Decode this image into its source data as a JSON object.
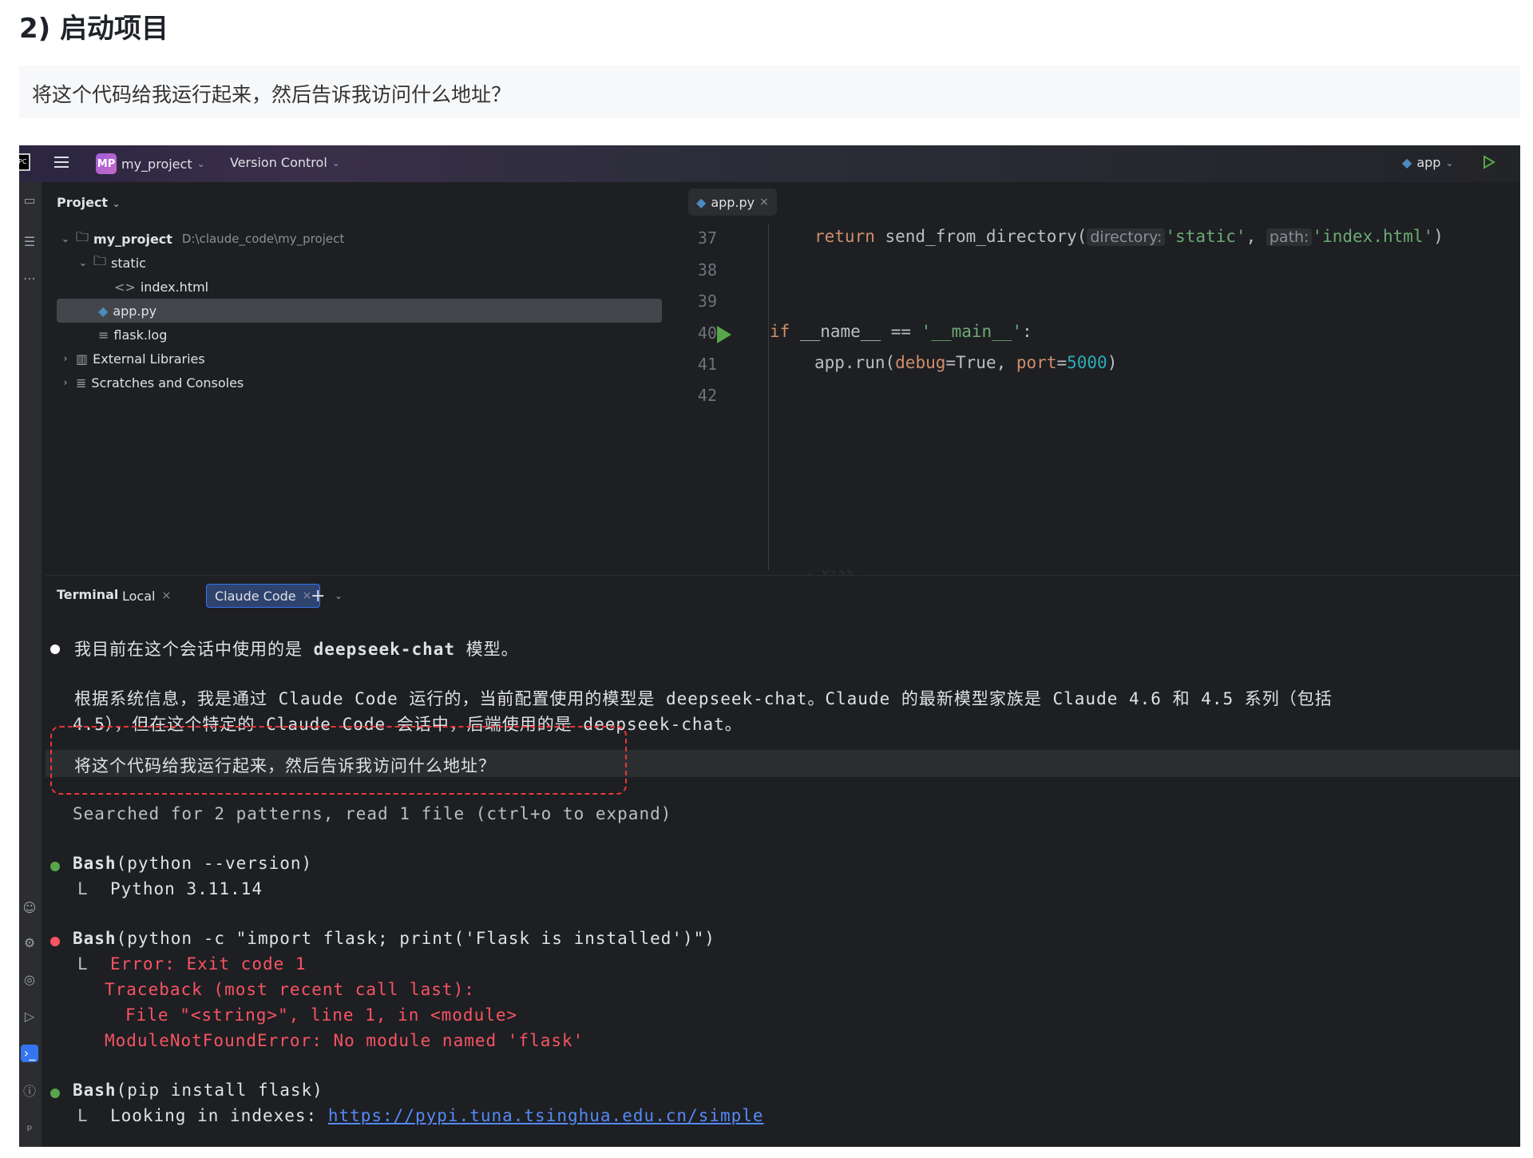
{
  "article": {
    "heading": "2) 启动项目",
    "quote": "将这个代码给我运行起来，然后告诉我访问什么地址？"
  },
  "titlebar": {
    "app_badge": "MP",
    "project_name": "my_project",
    "version_control": "Version Control",
    "run_config": "app"
  },
  "project_panel": {
    "title": "Project",
    "root_name": "my_project",
    "root_path": "D:\\claude_code\\my_project",
    "items": [
      {
        "label": "static"
      },
      {
        "label": "index.html"
      },
      {
        "label": "app.py"
      },
      {
        "label": "flask.log"
      },
      {
        "label": "External Libraries"
      },
      {
        "label": "Scratches and Consoles"
      }
    ]
  },
  "editor": {
    "tab_label": "app.py",
    "line_numbers": [
      "37",
      "38",
      "39",
      "40",
      "41",
      "42"
    ],
    "code": {
      "l37_return": "return",
      "l37_call": " send_from_directory(",
      "l37_hint1": "directory:",
      "l37_arg1": "'static'",
      "l37_comma": ", ",
      "l37_hint2": "path:",
      "l37_arg2": "'index.html'",
      "l37_close": ")",
      "l40_if": "if",
      "l40_cond": " __name__ == ",
      "l40_str": "'__main__'",
      "l40_colon": ":",
      "l41_call": "app.run(",
      "l41_p1": "debug",
      "l41_eq1": "=True, ",
      "l41_p2": "port",
      "l41_eq2": "=",
      "l41_num": "5000",
      "l41_close": ")"
    }
  },
  "terminal": {
    "title": "Terminal",
    "tabs": [
      {
        "label": "Local"
      },
      {
        "label": "Claude Code"
      }
    ],
    "lines": {
      "model_a": "我目前在这个会话中使用的是 ",
      "model_b": "deepseek-chat",
      "model_c": " 模型。",
      "info1": "根据系统信息，我是通过 Claude Code 运行的，当前配置使用的模型是 deepseek-chat。Claude 的最新模型家族是 Claude 4.6 和 4.5 系列（包括",
      "info2": "4.5），但在这个特定的 Claude Code 会话中，后端使用的是 deepseek-chat。",
      "user_prompt": "将这个代码给我运行起来，然后告诉我访问什么地址？",
      "searched": "Searched for 2 patterns, read 1 file (ctrl+o to expand)",
      "bash1_cmd": "Bash",
      "bash1_args": "(python --version)",
      "bash1_out": "Python 3.11.14",
      "bash2_cmd": "Bash",
      "bash2_args": "(python -c \"import flask; print('Flask is installed')\")",
      "bash2_err1": "Error: Exit code 1",
      "bash2_err2": "Traceback (most recent call last):",
      "bash2_err3": "File \"<string>\", line 1, in <module>",
      "bash2_err4": "ModuleNotFoundError: No module named 'flask'",
      "bash3_cmd": "Bash",
      "bash3_args": "(pip install flask)",
      "bash3_out_label": "Looking in indexes: ",
      "bash3_out_link": "https://pypi.tuna.tsinghua.edu.cn/simple",
      "branch": "L"
    }
  },
  "colors": {
    "success_dot": "#57a64a",
    "error_dot": "#f75464",
    "highlight_box": "#e53935"
  }
}
